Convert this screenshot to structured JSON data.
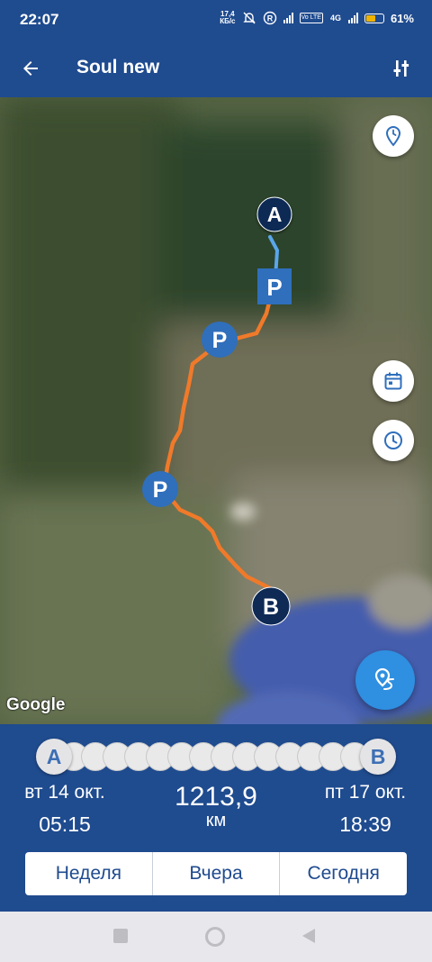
{
  "status": {
    "time": "22:07",
    "net_speed_value": "17,4",
    "net_speed_unit": "КБ/с",
    "volte": "Vo LTE",
    "network": "4G",
    "battery_pct": "61%",
    "battery_level": 0.61
  },
  "app_bar": {
    "title": "Soul new",
    "back_icon": "arrow-left-icon",
    "filter_icon": "sliders-icon"
  },
  "map": {
    "google_label": "Google",
    "start_marker": "A",
    "end_marker": "B",
    "parking_label": "P",
    "parking_count": 3,
    "icons": [
      "place-time-icon",
      "calendar-icon",
      "clock-icon",
      "route-pin-icon"
    ],
    "colors": {
      "route": "#f07a2a",
      "route_start": "#5aa6ea",
      "marker": "#0e2a55",
      "parking": "#2f6fbc"
    }
  },
  "panel": {
    "slider_start": "A",
    "slider_end": "B",
    "start_date": "вт 14 окт.",
    "start_time": "05:15",
    "end_date": "пт 17 окт.",
    "end_time": "18:39",
    "distance_value": "1213,9",
    "distance_unit": "км",
    "tabs": [
      "Неделя",
      "Вчера",
      "Сегодня"
    ]
  },
  "nav": {
    "icons": [
      "recents-square-icon",
      "home-circle-icon",
      "back-triangle-icon"
    ]
  }
}
